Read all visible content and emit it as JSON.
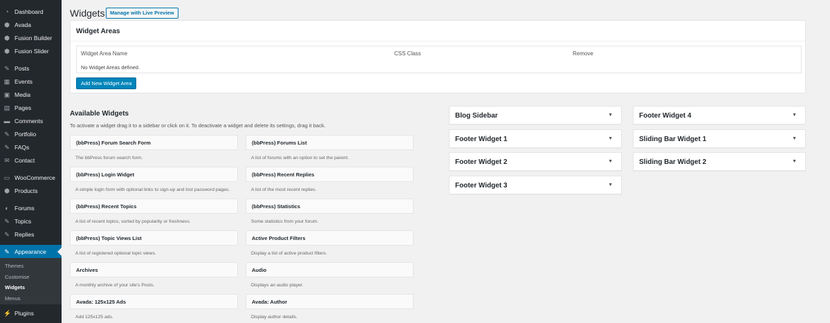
{
  "sidebar": {
    "items": [
      {
        "label": "Dashboard",
        "icon": "dashboard-icon",
        "glyph": "◔"
      },
      {
        "label": "Avada",
        "icon": "avada-icon",
        "glyph": "⬢"
      },
      {
        "label": "Fusion Builder",
        "icon": "fusion-builder-icon",
        "glyph": "⬢"
      },
      {
        "label": "Fusion Slider",
        "icon": "fusion-slider-icon",
        "glyph": "⬢"
      },
      {
        "label": "Posts",
        "icon": "pin-icon",
        "glyph": "✎"
      },
      {
        "label": "Events",
        "icon": "calendar-icon",
        "glyph": "▦"
      },
      {
        "label": "Media",
        "icon": "media-icon",
        "glyph": "▣"
      },
      {
        "label": "Pages",
        "icon": "pages-icon",
        "glyph": "▤"
      },
      {
        "label": "Comments",
        "icon": "comments-icon",
        "glyph": "▬"
      },
      {
        "label": "Portfolio",
        "icon": "portfolio-pin-icon",
        "glyph": "✎"
      },
      {
        "label": "FAQs",
        "icon": "faqs-pin-icon",
        "glyph": "✎"
      },
      {
        "label": "Contact",
        "icon": "contact-icon",
        "glyph": "✉"
      },
      {
        "label": "WooCommerce",
        "icon": "woocommerce-icon",
        "glyph": "▭"
      },
      {
        "label": "Products",
        "icon": "products-icon",
        "glyph": "⬢"
      },
      {
        "label": "Forums",
        "icon": "forums-icon",
        "glyph": "◐"
      },
      {
        "label": "Topics",
        "icon": "topics-icon",
        "glyph": "✎"
      },
      {
        "label": "Replies",
        "icon": "replies-icon",
        "glyph": "✎"
      },
      {
        "label": "Appearance",
        "icon": "appearance-brush-icon",
        "glyph": "✎"
      },
      {
        "label": "Plugins",
        "icon": "plugins-icon",
        "glyph": "⚡"
      }
    ],
    "submenu": [
      "Themes",
      "Customise",
      "Widgets",
      "Menus"
    ]
  },
  "header": {
    "title": "Widgets",
    "live_preview_label": "Manage with Live Preview"
  },
  "widget_areas": {
    "title": "Widget Areas",
    "columns": [
      "Widget Area Name",
      "CSS Class",
      "Remove"
    ],
    "empty_text": "No Widget Areas defined.",
    "add_button": "Add New Widget Area"
  },
  "available": {
    "title": "Available Widgets",
    "description": "To activate a widget drag it to a sidebar or click on it. To deactivate a widget and delete its settings, drag it back.",
    "widgets": [
      {
        "title": "(bbPress) Forum Search Form",
        "desc": "The bbPress forum search form."
      },
      {
        "title": "(bbPress) Forums List",
        "desc": "A list of forums with an option to set the parent."
      },
      {
        "title": "(bbPress) Login Widget",
        "desc": "A simple login form with optional links to sign-up and lost password pages."
      },
      {
        "title": "(bbPress) Recent Replies",
        "desc": "A list of the most recent replies."
      },
      {
        "title": "(bbPress) Recent Topics",
        "desc": "A list of recent topics, sorted by popularity or freshness."
      },
      {
        "title": "(bbPress) Statistics",
        "desc": "Some statistics from your forum."
      },
      {
        "title": "(bbPress) Topic Views List",
        "desc": "A list of registered optional topic views."
      },
      {
        "title": "Active Product Filters",
        "desc": "Display a list of active product filters."
      },
      {
        "title": "Archives",
        "desc": "A monthly archive of your site's Posts."
      },
      {
        "title": "Audio",
        "desc": "Displays an audio player."
      },
      {
        "title": "Avada: 125x125 Ads",
        "desc": "Add 125x125 ads."
      },
      {
        "title": "Avada: Author",
        "desc": "Display author details."
      }
    ]
  },
  "sidebars": [
    {
      "title": "Blog Sidebar"
    },
    {
      "title": "Footer Widget 1"
    },
    {
      "title": "Footer Widget 2"
    },
    {
      "title": "Footer Widget 3"
    },
    {
      "title": "Footer Widget 4"
    },
    {
      "title": "Sliding Bar Widget 1"
    },
    {
      "title": "Sliding Bar Widget 2"
    }
  ],
  "colors": {
    "sidebar_bg": "#23282d",
    "active_bg": "#0073aa",
    "primary_button": "#0085ba"
  }
}
